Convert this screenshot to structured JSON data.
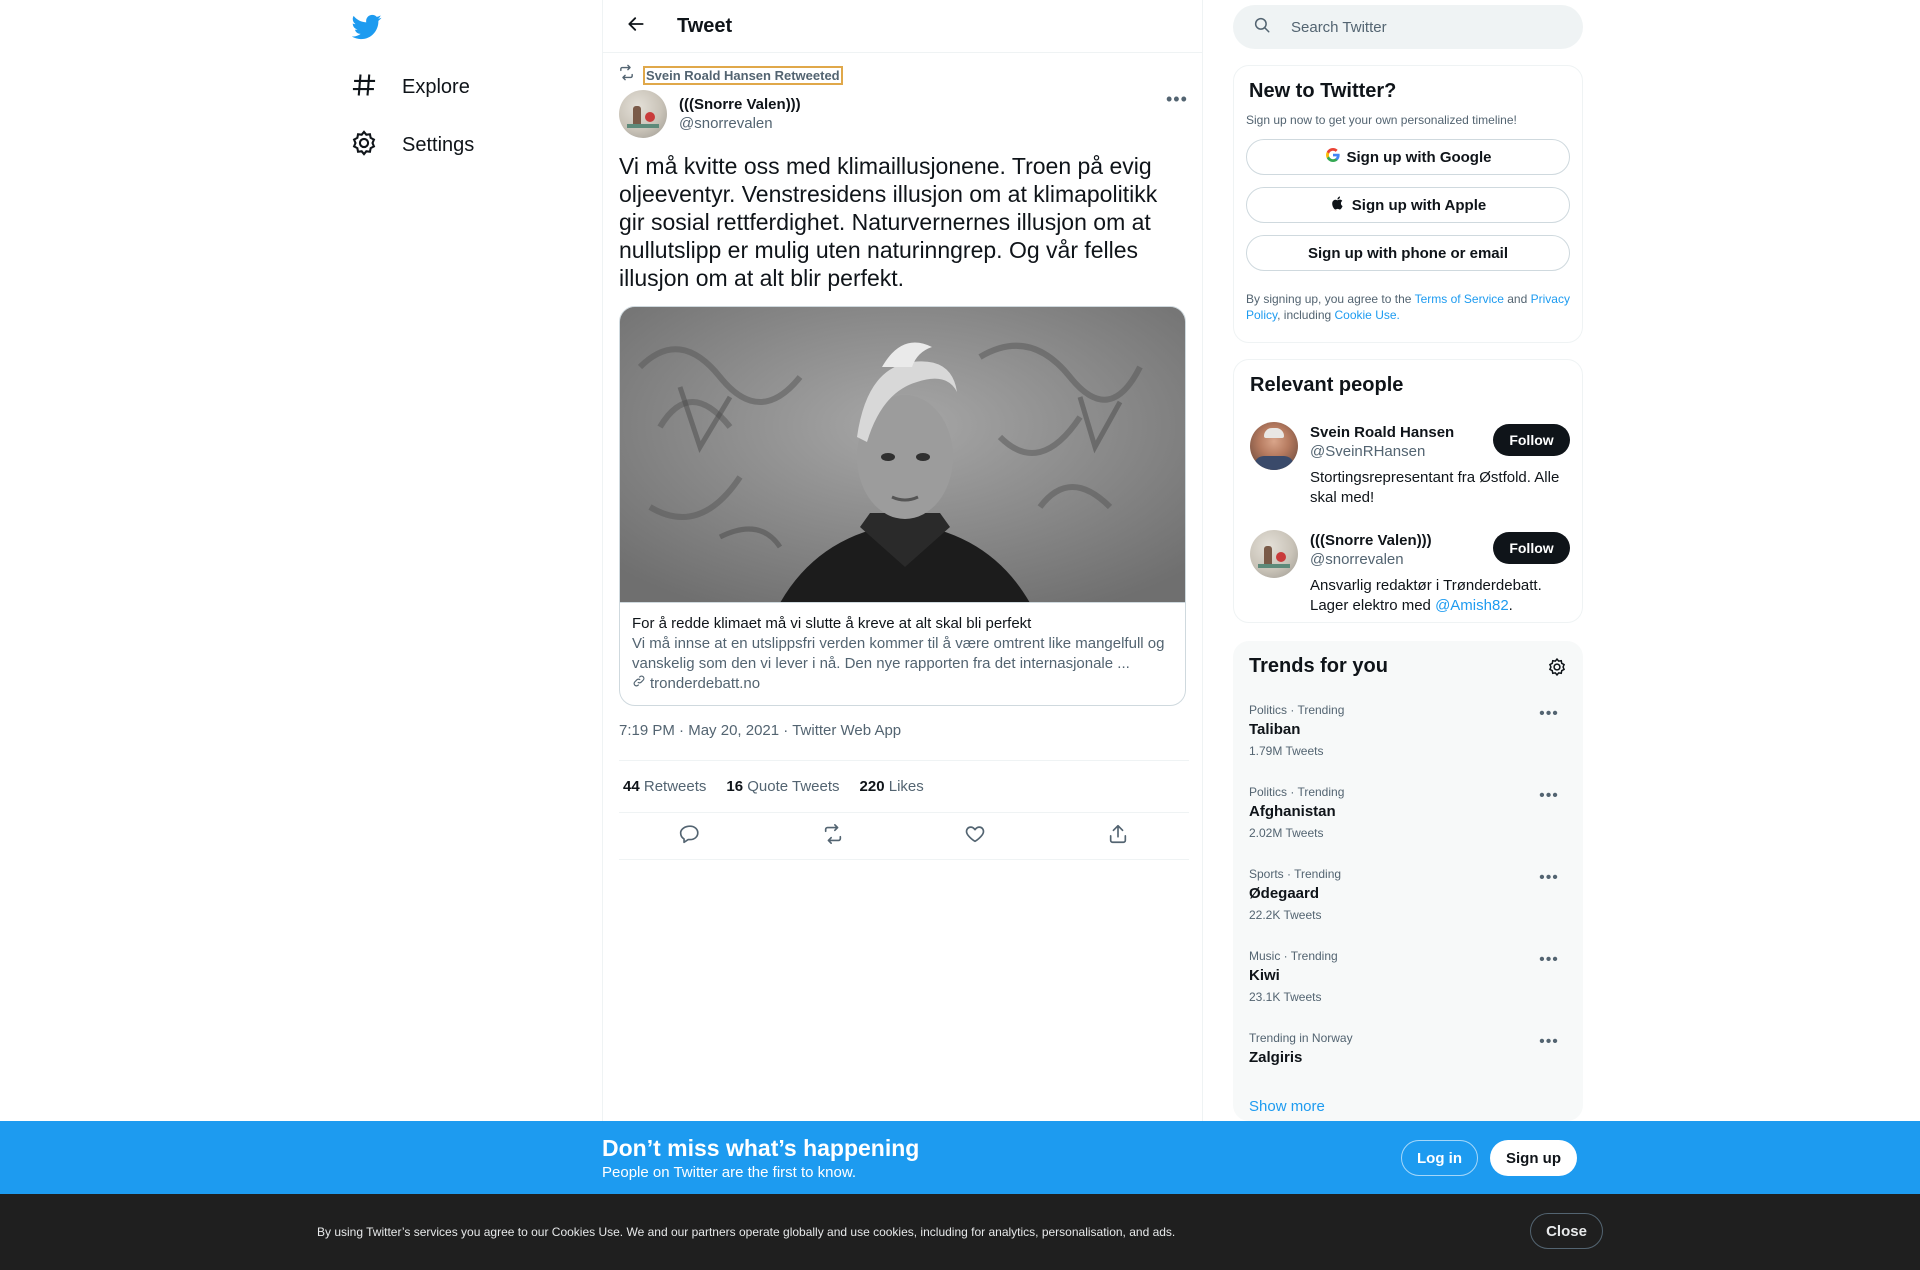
{
  "nav": {
    "items": [
      {
        "label": "Explore"
      },
      {
        "label": "Settings"
      }
    ]
  },
  "header": {
    "title": "Tweet"
  },
  "tweet": {
    "retweeted_by": "Svein Roald Hansen Retweeted",
    "author_name": "(((Snorre Valen)))",
    "author_handle": "@snorrevalen",
    "text": "Vi må kvitte oss med klimaillusjonene. Troen på evig oljeeventyr. Venstresidens illusjon om at klimapolitikk gir sosial rettferdighet. Naturvernernes illusjon om at nullutslipp er mulig uten naturinngrep. Og vår felles illusjon om at alt blir perfekt.",
    "card": {
      "title": "For å redde klimaet må vi slutte å kreve at alt skal bli perfekt",
      "description": "Vi må innse at en utslippsfri verden kommer til å være omtrent like mangelfull og vanskelig som den vi lever i nå. Den nye rapporten fra det internasjonale ...",
      "domain": "tronderdebatt.no"
    },
    "time": "7:19 PM",
    "date": "May 20, 2021",
    "source": "Twitter Web App",
    "retweets_count": "44",
    "retweets_label": "Retweets",
    "quotes_count": "16",
    "quotes_label": "Quote Tweets",
    "likes_count": "220",
    "likes_label": "Likes"
  },
  "search": {
    "placeholder": "Search Twitter"
  },
  "new_to_twitter": {
    "title": "New to Twitter?",
    "subtitle": "Sign up now to get your own personalized timeline!",
    "google_label": "Sign up with Google",
    "apple_label": "Sign up with Apple",
    "phone_label": "Sign up with phone or email",
    "legal_prefix": "By signing up, you agree to the ",
    "terms": "Terms of Service",
    "and": " and ",
    "privacy": "Privacy Policy",
    "including": ", including ",
    "cookie": "Cookie Use."
  },
  "relevant_people": {
    "title": "Relevant people",
    "follow_label": "Follow",
    "people": [
      {
        "name": "Svein Roald Hansen",
        "handle": "@SveinRHansen",
        "bio": "Stortingsrepresentant fra Østfold. Alle skal med!"
      },
      {
        "name": "(((Snorre Valen)))",
        "handle": "@snorrevalen",
        "bio_prefix": "Ansvarlig redaktør i Trønderdebatt. Lager elektro med ",
        "bio_link": "@Amish82",
        "bio_suffix": "."
      }
    ]
  },
  "trends": {
    "title": "Trends for you",
    "items": [
      {
        "context": "Politics · Trending",
        "name": "Taliban",
        "count": "1.79M Tweets"
      },
      {
        "context": "Politics · Trending",
        "name": "Afghanistan",
        "count": "2.02M Tweets"
      },
      {
        "context": "Sports · Trending",
        "name": "Ødegaard",
        "count": "22.2K Tweets"
      },
      {
        "context": "Music · Trending",
        "name": "Kiwi",
        "count": "23.1K Tweets"
      },
      {
        "context": "Trending in Norway",
        "name": "Zalgiris",
        "count": ""
      }
    ],
    "show_more": "Show more"
  },
  "banner": {
    "title": "Don’t miss what’s happening",
    "subtitle": "People on Twitter are the first to know.",
    "login_label": "Log in",
    "signup_label": "Sign up"
  },
  "cookie_bar": {
    "text": "By using Twitter’s services you agree to our Cookies Use. We and our partners operate globally and use cookies, including for analytics, personalisation, and ads.",
    "close_label": "Close"
  },
  "colors": {
    "accent": "#1d9bf0",
    "text": "#0f1419",
    "muted": "#536471",
    "cookie_bg": "#1f1f1f"
  }
}
